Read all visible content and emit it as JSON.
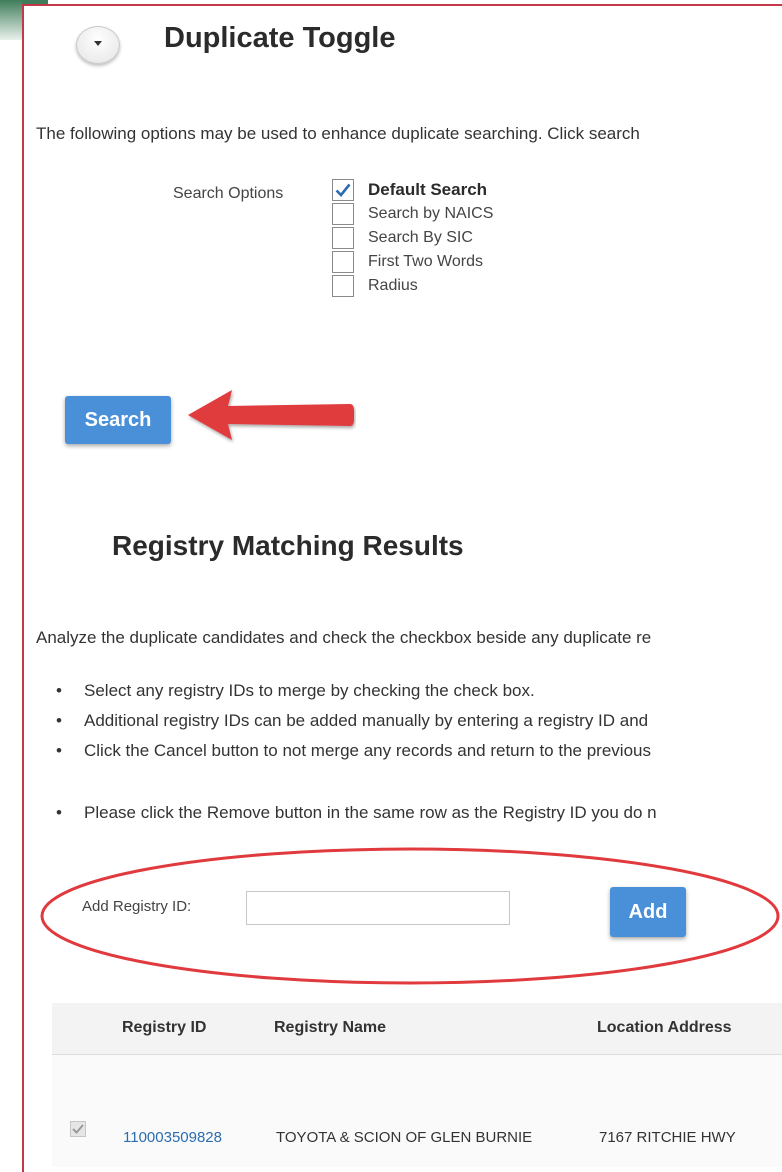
{
  "section": {
    "toggle_title": "Duplicate Toggle",
    "intro_text": "The following options may be used to enhance duplicate searching. Click search"
  },
  "search_options": {
    "label": "Search Options",
    "items": [
      {
        "label": "Default Search",
        "checked": true
      },
      {
        "label": "Search by NAICS",
        "checked": false
      },
      {
        "label": "Search By SIC",
        "checked": false
      },
      {
        "label": "First Two Words",
        "checked": false
      },
      {
        "label": "Radius",
        "checked": false
      }
    ],
    "search_button": "Search"
  },
  "results": {
    "title": "Registry Matching Results",
    "analyze_text": "Analyze the duplicate candidates and check the checkbox beside any duplicate re",
    "bullets": [
      "Select any registry IDs to merge by checking the check box.",
      "Additional registry IDs can be added manually by entering a registry ID and",
      "Click the Cancel button to not merge any records and return to the previous"
    ],
    "bullet_extra": "Please click the Remove button in the same row as the Registry ID you do n"
  },
  "add_registry": {
    "label": "Add Registry ID:",
    "input_value": "",
    "button": "Add"
  },
  "table": {
    "headers": [
      "Registry ID",
      "Registry Name",
      "Location Address"
    ],
    "rows": [
      {
        "registry_id": "110003509828",
        "registry_name": "TOYOTA & SCION OF GLEN BURNIE",
        "location_address": "7167 RITCHIE HWY",
        "checked": true
      }
    ]
  },
  "colors": {
    "button_blue": "#4a90d9",
    "annotation_red": "#e03a3e",
    "link_blue": "#2a6db0"
  }
}
